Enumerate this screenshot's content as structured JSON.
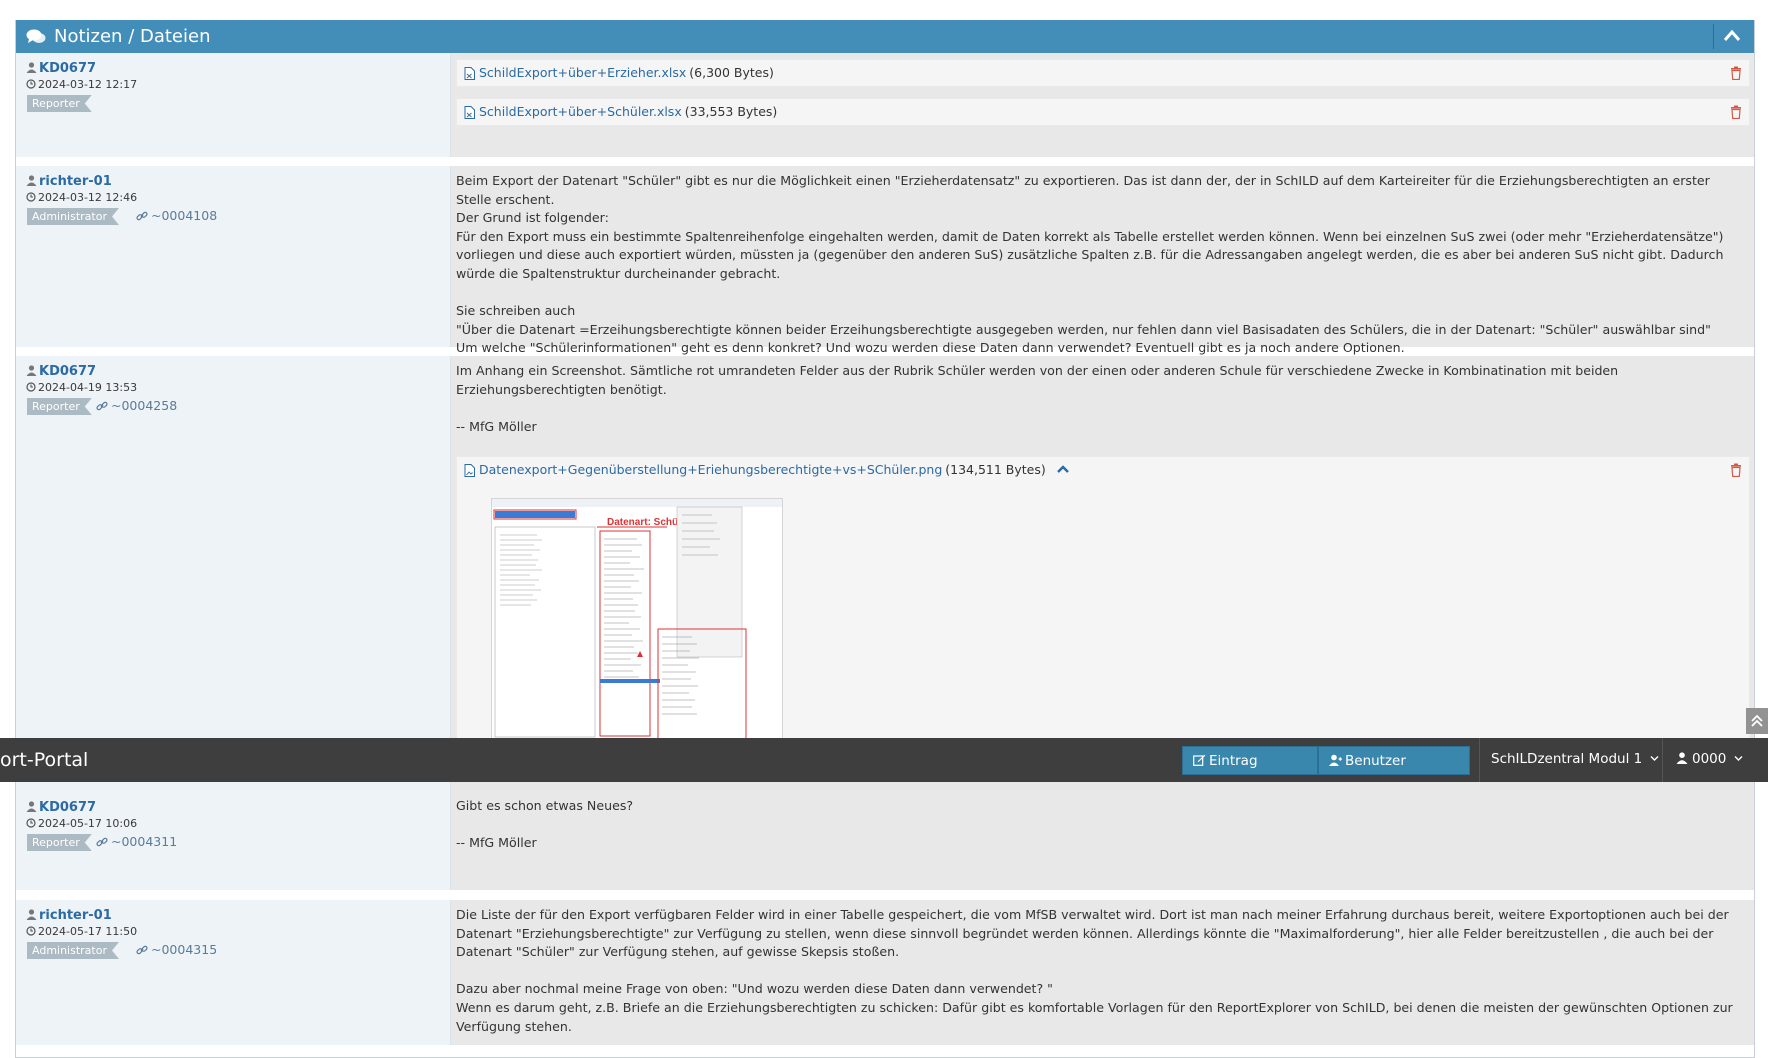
{
  "panel": {
    "title": "Notizen / Dateien"
  },
  "notes": [
    {
      "user": "KD0677",
      "date": "2024-03-12 12:17",
      "role": "Reporter",
      "link": "",
      "files": [
        {
          "name": "SchildExport+über+Erzieher.xlsx",
          "size": "(6,300 Bytes)"
        },
        {
          "name": "SchildExport+über+Schüler.xlsx",
          "size": "(33,553 Bytes)"
        }
      ]
    },
    {
      "user": "richter-01",
      "date": "2024-03-12 12:46",
      "role": "Administrator",
      "link": "~0004108",
      "text": "Beim Export der Datenart \"Schüler\" gibt es nur die Möglichkeit einen \"Erzieherdatensatz\" zu exportieren. Das ist dann der, der in SchILD auf dem Karteireiter für die Erziehungsberechtigten an erster Stelle erschent.\nDer Grund ist folgender:\nFür den Export muss ein bestimmte Spaltenreihenfolge eingehalten werden, damit de Daten korrekt als Tabelle erstellet werden können. Wenn bei einzelnen SuS zwei (oder mehr \"Erzieherdatensätze\") vorliegen und diese auch exportiert würden, müssten ja (gegenüber den anderen SuS) zusätzliche Spalten z.B. für die Adressangaben angelegt werden, die es aber bei anderen SuS nicht gibt. Dadurch würde die Spaltenstruktur durcheinander gebracht.\n\nSie schreiben auch\n\"Über die Datenart =Erzeihungsberechtigte können beider Erzeihungsberechtigte ausgegeben werden, nur fehlen dann viel Basisadaten des Schülers, die in der Datenart: \"Schüler\" auswählbar sind\"\nUm welche \"Schülerinformationen\" geht es denn konkret? Und wozu werden diese Daten dann verwendet? Eventuell gibt es ja noch andere Optionen."
    },
    {
      "user": "KD0677",
      "date": "2024-04-19 13:53",
      "role": "Reporter",
      "link": "~0004258",
      "text": "Im Anhang ein Screenshot. Sämtliche rot umrandeten Felder aus der Rubrik Schüler werden von der einen oder anderen Schule für verschiedene Zwecke in Kombinatination mit beiden Erziehungsberechtigten benötigt.\n\n-- MfG Möller",
      "files": [
        {
          "name": "Datenexport+Gegenüberstellung+Eriehungsberechtigte+vs+SChüler.png",
          "size": "(134,511 Bytes)"
        }
      ],
      "thumb": {
        "heading": "Datenart: Schüler"
      }
    },
    {
      "user": "KD0677",
      "date": "2024-05-17 10:06",
      "role": "Reporter",
      "link": "~0004311",
      "text": "Gibt es schon etwas Neues?\n\n-- MfG Möller"
    },
    {
      "user": "richter-01",
      "date": "2024-05-17 11:50",
      "role": "Administrator",
      "link": "~0004315",
      "text": "Die Liste der für den Export verfügbaren Felder wird in einer Tabelle gespeichert, die vom MfSB verwaltet wird. Dort ist man nach meiner Erfahrung durchaus bereit, weitere Exportoptionen auch bei der Datenart \"Erziehungsberechtigte\" zur Verfügung zu stellen, wenn diese sinnvoll begründet werden können. Allerdings könnte die \"Maximalforderung\", hier alle Felder bereitzustellen , die auch bei der Datenart \"Schüler\" zur Verfügung stehen, auf gewisse Skepsis stoßen.\n\nDazu aber nochmal meine Frage von oben: \"Und wozu werden diese Daten dann verwendet? \"\nWenn es darum geht, z.B. Briefe an die Erziehungsberechtigten zu schicken: Dafür gibt es komfortable Vorlagen für den ReportExplorer von SchILD, bei denen die meisten der gewünschten Optionen zur Verfügung stehen."
    }
  ],
  "navbar": {
    "brand": "ort-Portal",
    "btn_entry": "Eintrag erfassen",
    "btn_invite": "Benutzer einladen",
    "project": "SchILDzentral Modul 1",
    "account": "0000"
  },
  "colors": {
    "header": "#438eb9",
    "navbar": "#3e3e3e",
    "link": "#2b6aa3",
    "delete": "#d15b47"
  }
}
